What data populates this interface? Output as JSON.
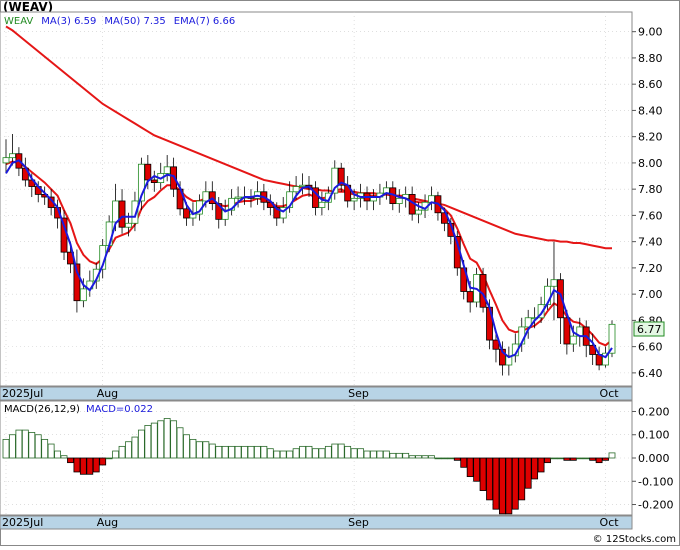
{
  "ticker_title": "(WEAV)",
  "watermark": "© 12Stocks.com",
  "price_panel": {
    "legend": {
      "symbol": "WEAV",
      "ma3": "MA(3)  6.59",
      "ma50": "MA(50)  7.35",
      "ema7": "EMA(7)  6.66"
    },
    "last_price_label": "6.77",
    "y_ticks": [
      "9.00",
      "8.80",
      "8.60",
      "8.40",
      "8.20",
      "8.00",
      "7.80",
      "7.60",
      "7.40",
      "7.20",
      "7.00",
      "6.80",
      "6.60",
      "6.40"
    ],
    "month_labels": [
      "2025Jul",
      "Aug",
      "Sep",
      "Oct"
    ]
  },
  "macd_panel": {
    "legend": {
      "name": "MACD(26,12,9)",
      "value": "MACD=0.022"
    },
    "y_ticks": [
      "0.200",
      "0.100",
      "0.000",
      "-0.100",
      "-0.200"
    ],
    "month_labels": [
      "2025Jul",
      "Aug",
      "Sep",
      "Oct"
    ]
  },
  "colors": {
    "up_candle": "#228b22",
    "down_candle": "#dd0000",
    "ma3_line": "#1a1adc",
    "ma50_line": "#e51616",
    "ema7_line": "#e51616",
    "axis_band": "#b8d4e6",
    "grid": "#cccccc",
    "macd_up": "#2a6a2a",
    "macd_down": "#dd0000"
  },
  "chart_data": [
    {
      "type": "candlestick",
      "title": "(WEAV)",
      "ylim": [
        6.3,
        9.15
      ],
      "months": [
        {
          "label": "2025Jul",
          "index": 0
        },
        {
          "label": "Aug",
          "index": 15
        },
        {
          "label": "Sep",
          "index": 54
        },
        {
          "label": "Oct",
          "index": 93
        }
      ],
      "open": [
        8.0,
        8.04,
        8.07,
        7.96,
        7.87,
        7.82,
        7.76,
        7.74,
        7.66,
        7.58,
        7.32,
        7.23,
        6.95,
        7.04,
        7.1,
        7.19,
        7.37,
        7.55,
        7.71,
        7.51,
        7.54,
        7.71,
        7.99,
        7.87,
        7.85,
        7.92,
        7.97,
        7.8,
        7.65,
        7.58,
        7.61,
        7.71,
        7.78,
        7.69,
        7.57,
        7.64,
        7.73,
        7.74,
        7.74,
        7.73,
        7.78,
        7.7,
        7.66,
        7.58,
        7.66,
        7.78,
        7.82,
        7.83,
        7.81,
        7.66,
        7.7,
        7.77,
        7.96,
        7.83,
        7.71,
        7.73,
        7.77,
        7.71,
        7.74,
        7.77,
        7.81,
        7.69,
        7.73,
        7.76,
        7.61,
        7.64,
        7.7,
        7.75,
        7.62,
        7.54,
        7.44,
        7.2,
        7.02,
        6.94,
        7.15,
        6.9,
        6.65,
        6.58,
        6.46,
        6.53,
        6.62,
        6.75,
        6.82,
        6.82,
        6.92,
        7.06,
        7.11,
        6.82,
        6.62,
        6.68,
        6.75,
        6.61,
        6.54,
        6.46,
        6.55
      ],
      "close": [
        8.04,
        8.07,
        7.96,
        7.87,
        7.82,
        7.76,
        7.74,
        7.66,
        7.58,
        7.32,
        7.23,
        6.95,
        7.04,
        7.1,
        7.19,
        7.37,
        7.55,
        7.71,
        7.51,
        7.54,
        7.71,
        7.99,
        7.87,
        7.85,
        7.92,
        7.97,
        7.8,
        7.65,
        7.58,
        7.61,
        7.71,
        7.78,
        7.69,
        7.57,
        7.64,
        7.73,
        7.74,
        7.74,
        7.73,
        7.78,
        7.7,
        7.66,
        7.58,
        7.66,
        7.78,
        7.82,
        7.83,
        7.81,
        7.66,
        7.7,
        7.77,
        7.96,
        7.83,
        7.71,
        7.73,
        7.77,
        7.71,
        7.74,
        7.77,
        7.81,
        7.69,
        7.73,
        7.76,
        7.61,
        7.64,
        7.7,
        7.75,
        7.62,
        7.54,
        7.44,
        7.2,
        7.02,
        6.94,
        7.15,
        6.9,
        6.65,
        6.58,
        6.46,
        6.53,
        6.62,
        6.75,
        6.82,
        6.82,
        6.92,
        7.06,
        7.11,
        6.82,
        6.62,
        6.68,
        6.75,
        6.61,
        6.54,
        6.46,
        6.55,
        6.77
      ],
      "high": [
        8.18,
        8.22,
        8.12,
        8.04,
        7.92,
        7.86,
        7.82,
        7.8,
        7.72,
        7.64,
        7.4,
        7.34,
        7.12,
        7.18,
        7.24,
        7.42,
        7.6,
        7.84,
        7.8,
        7.62,
        7.78,
        8.04,
        8.06,
        7.94,
        8.0,
        8.06,
        8.04,
        7.86,
        7.7,
        7.7,
        7.76,
        7.86,
        7.86,
        7.74,
        7.72,
        7.8,
        7.82,
        7.82,
        7.8,
        7.86,
        7.84,
        7.76,
        7.7,
        7.74,
        7.86,
        7.9,
        7.92,
        7.9,
        7.86,
        7.78,
        7.82,
        8.02,
        8.0,
        7.9,
        7.8,
        7.84,
        7.82,
        7.8,
        7.84,
        7.86,
        7.86,
        7.8,
        7.82,
        7.82,
        7.7,
        7.76,
        7.82,
        7.78,
        7.66,
        7.58,
        7.48,
        7.26,
        7.1,
        7.2,
        7.2,
        6.96,
        6.72,
        6.64,
        6.6,
        6.7,
        6.82,
        6.88,
        6.9,
        6.98,
        7.12,
        7.4,
        7.16,
        6.88,
        6.76,
        6.82,
        6.8,
        6.7,
        6.6,
        6.6,
        6.8
      ],
      "low": [
        7.92,
        7.98,
        7.9,
        7.82,
        7.74,
        7.7,
        7.68,
        7.6,
        7.5,
        7.26,
        7.16,
        6.86,
        6.9,
        6.98,
        7.04,
        7.12,
        7.32,
        7.48,
        7.46,
        7.44,
        7.48,
        7.64,
        7.8,
        7.78,
        7.8,
        7.86,
        7.74,
        7.6,
        7.52,
        7.52,
        7.56,
        7.66,
        7.64,
        7.5,
        7.52,
        7.6,
        7.66,
        7.68,
        7.66,
        7.68,
        7.64,
        7.6,
        7.52,
        7.54,
        7.62,
        7.72,
        7.76,
        7.74,
        7.6,
        7.6,
        7.64,
        7.72,
        7.78,
        7.66,
        7.64,
        7.66,
        7.64,
        7.64,
        7.68,
        7.72,
        7.64,
        7.62,
        7.66,
        7.56,
        7.54,
        7.58,
        7.64,
        7.56,
        7.48,
        7.38,
        7.14,
        6.96,
        6.86,
        6.9,
        6.86,
        6.58,
        6.48,
        6.38,
        6.38,
        6.48,
        6.56,
        6.66,
        6.74,
        6.78,
        6.88,
        6.8,
        6.62,
        6.54,
        6.56,
        6.6,
        6.52,
        6.46,
        6.42,
        6.44,
        6.52
      ],
      "series": [
        {
          "name": "MA(3)",
          "values": [
            7.92,
            8.0,
            8.02,
            7.97,
            7.88,
            7.82,
            7.77,
            7.72,
            7.66,
            7.52,
            7.38,
            7.17,
            7.07,
            7.03,
            7.11,
            7.22,
            7.37,
            7.54,
            7.59,
            7.59,
            7.59,
            7.75,
            7.86,
            7.9,
            7.88,
            7.91,
            7.9,
            7.81,
            7.68,
            7.61,
            7.63,
            7.7,
            7.73,
            7.68,
            7.63,
            7.65,
            7.7,
            7.74,
            7.74,
            7.75,
            7.74,
            7.71,
            7.65,
            7.63,
            7.67,
            7.75,
            7.81,
            7.82,
            7.77,
            7.72,
            7.71,
            7.81,
            7.85,
            7.83,
            7.76,
            7.74,
            7.74,
            7.74,
            7.74,
            7.77,
            7.76,
            7.74,
            7.73,
            7.7,
            7.67,
            7.65,
            7.7,
            7.69,
            7.64,
            7.53,
            7.39,
            7.22,
            7.05,
            7.04,
            7.0,
            6.9,
            6.71,
            6.56,
            6.52,
            6.54,
            6.63,
            6.73,
            6.8,
            6.85,
            6.93,
            7.03,
            7.0,
            6.85,
            6.71,
            6.68,
            6.68,
            6.63,
            6.54,
            6.52,
            6.59
          ]
        },
        {
          "name": "MA(50)",
          "values": [
            9.04,
            9.01,
            8.97,
            8.93,
            8.89,
            8.85,
            8.81,
            8.77,
            8.73,
            8.69,
            8.65,
            8.61,
            8.57,
            8.53,
            8.49,
            8.45,
            8.42,
            8.39,
            8.36,
            8.33,
            8.3,
            8.27,
            8.24,
            8.21,
            8.19,
            8.17,
            8.15,
            8.13,
            8.11,
            8.09,
            8.07,
            8.05,
            8.03,
            8.01,
            7.99,
            7.97,
            7.95,
            7.93,
            7.91,
            7.89,
            7.87,
            7.86,
            7.85,
            7.84,
            7.83,
            7.82,
            7.81,
            7.8,
            7.8,
            7.79,
            7.79,
            7.78,
            7.78,
            7.78,
            7.78,
            7.77,
            7.77,
            7.77,
            7.76,
            7.76,
            7.75,
            7.75,
            7.74,
            7.73,
            7.72,
            7.71,
            7.7,
            7.69,
            7.68,
            7.66,
            7.64,
            7.62,
            7.6,
            7.58,
            7.56,
            7.54,
            7.52,
            7.5,
            7.48,
            7.46,
            7.45,
            7.44,
            7.43,
            7.42,
            7.41,
            7.41,
            7.4,
            7.4,
            7.39,
            7.39,
            7.38,
            7.37,
            7.36,
            7.35,
            7.35
          ]
        },
        {
          "name": "EMA(7)",
          "values": [
            7.99,
            8.01,
            8.0,
            7.97,
            7.93,
            7.89,
            7.85,
            7.8,
            7.75,
            7.64,
            7.54,
            7.39,
            7.3,
            7.25,
            7.23,
            7.27,
            7.34,
            7.43,
            7.45,
            7.47,
            7.53,
            7.65,
            7.71,
            7.74,
            7.79,
            7.83,
            7.83,
            7.79,
            7.74,
            7.71,
            7.71,
            7.73,
            7.72,
            7.68,
            7.67,
            7.68,
            7.7,
            7.71,
            7.71,
            7.73,
            7.72,
            7.7,
            7.67,
            7.67,
            7.69,
            7.72,
            7.75,
            7.76,
            7.74,
            7.73,
            7.74,
            7.79,
            7.8,
            7.77,
            7.76,
            7.76,
            7.75,
            7.75,
            7.75,
            7.76,
            7.75,
            7.75,
            7.75,
            7.71,
            7.7,
            7.7,
            7.71,
            7.69,
            7.65,
            7.6,
            7.5,
            7.38,
            7.27,
            7.24,
            7.15,
            7.03,
            6.92,
            6.8,
            6.73,
            6.71,
            6.72,
            6.74,
            6.76,
            6.8,
            6.87,
            6.93,
            6.9,
            6.83,
            6.79,
            6.78,
            6.74,
            6.69,
            6.63,
            6.61,
            6.65
          ]
        }
      ]
    },
    {
      "type": "bar",
      "title": "MACD(26,12,9)",
      "ylim": [
        -0.245,
        0.245
      ],
      "months": [
        {
          "label": "2025Jul",
          "index": 0
        },
        {
          "label": "Aug",
          "index": 15
        },
        {
          "label": "Sep",
          "index": 54
        },
        {
          "label": "Oct",
          "index": 93
        }
      ],
      "series": [
        {
          "name": "MACD",
          "values": [
            0.08,
            0.1,
            0.12,
            0.12,
            0.11,
            0.1,
            0.08,
            0.06,
            0.03,
            0.01,
            -0.02,
            -0.06,
            -0.07,
            -0.07,
            -0.06,
            -0.03,
            0.0,
            0.03,
            0.05,
            0.07,
            0.09,
            0.12,
            0.14,
            0.15,
            0.16,
            0.17,
            0.16,
            0.13,
            0.1,
            0.08,
            0.07,
            0.07,
            0.06,
            0.05,
            0.05,
            0.05,
            0.05,
            0.05,
            0.05,
            0.05,
            0.05,
            0.04,
            0.03,
            0.03,
            0.03,
            0.04,
            0.05,
            0.05,
            0.04,
            0.04,
            0.05,
            0.06,
            0.06,
            0.05,
            0.04,
            0.04,
            0.03,
            0.03,
            0.03,
            0.03,
            0.02,
            0.02,
            0.02,
            0.01,
            0.01,
            0.01,
            0.01,
            0.0,
            0.0,
            0.0,
            -0.01,
            -0.04,
            -0.08,
            -0.1,
            -0.14,
            -0.18,
            -0.22,
            -0.24,
            -0.24,
            -0.22,
            -0.18,
            -0.13,
            -0.09,
            -0.06,
            -0.02,
            0.0,
            0.0,
            -0.01,
            -0.01,
            0.0,
            0.0,
            -0.01,
            -0.02,
            -0.01,
            0.022
          ]
        }
      ]
    }
  ]
}
